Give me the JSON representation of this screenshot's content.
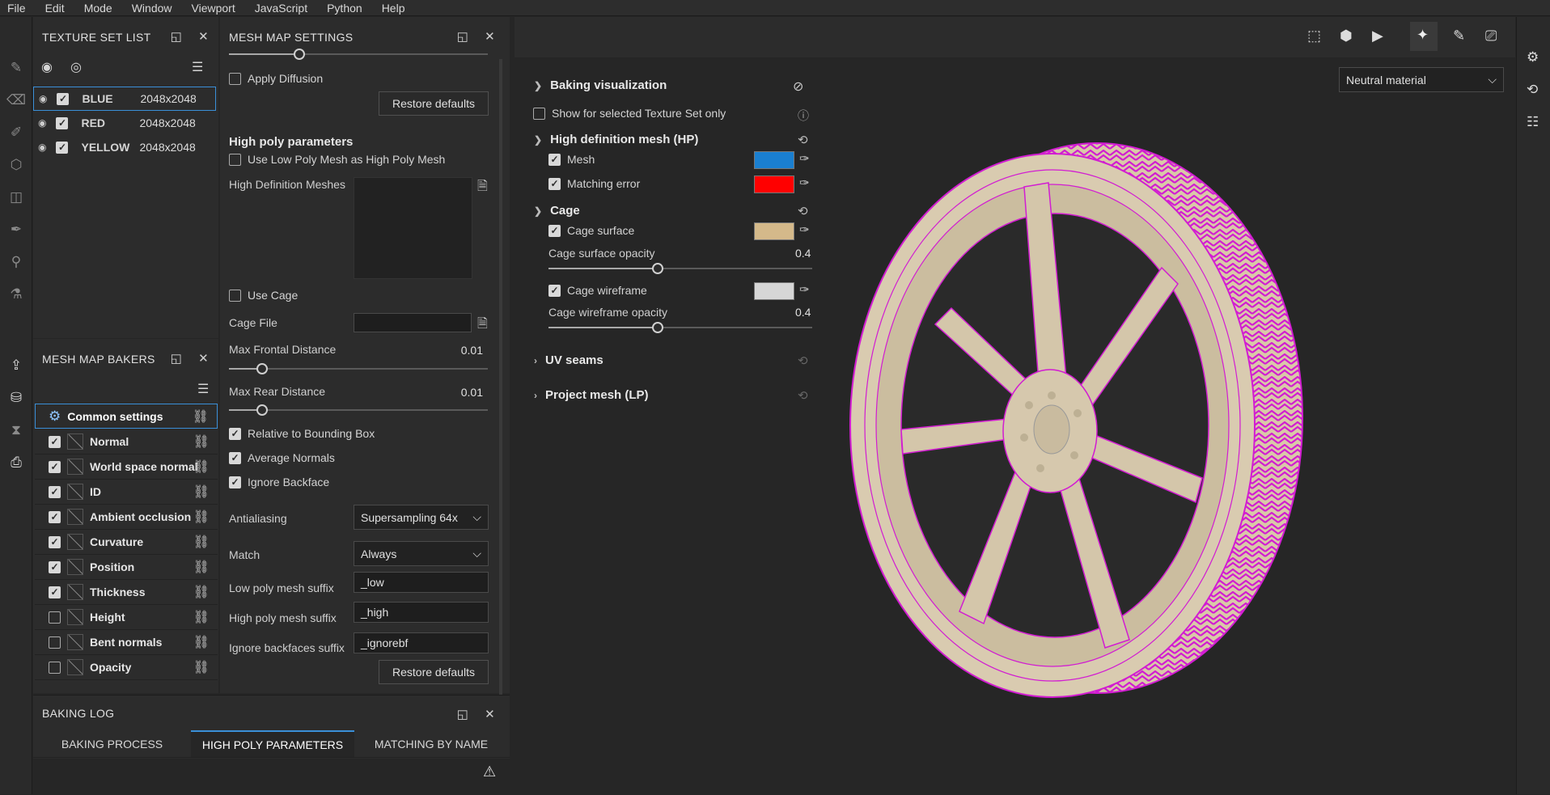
{
  "menu": [
    "File",
    "Edit",
    "Mode",
    "Window",
    "Viewport",
    "JavaScript",
    "Python",
    "Help"
  ],
  "texture_set_list": {
    "title": "TEXTURE SET LIST",
    "rows": [
      {
        "name": "BLUE",
        "size": "2048x2048"
      },
      {
        "name": "RED",
        "size": "2048x2048"
      },
      {
        "name": "YELLOW",
        "size": "2048x2048"
      }
    ]
  },
  "mesh_map_bakers": {
    "title": "MESH MAP BAKERS",
    "common": "Common settings",
    "items": [
      {
        "label": "Normal",
        "checked": true
      },
      {
        "label": "World space normal",
        "checked": true
      },
      {
        "label": "ID",
        "checked": true
      },
      {
        "label": "Ambient occlusion",
        "checked": true
      },
      {
        "label": "Curvature",
        "checked": true
      },
      {
        "label": "Position",
        "checked": true
      },
      {
        "label": "Thickness",
        "checked": true
      },
      {
        "label": "Height",
        "checked": false
      },
      {
        "label": "Bent normals",
        "checked": false
      },
      {
        "label": "Opacity",
        "checked": false
      }
    ]
  },
  "mesh_map_settings": {
    "title": "MESH MAP SETTINGS",
    "apply_diffusion": "Apply Diffusion",
    "restore_defaults_1": "Restore defaults",
    "high_poly_title": "High poly parameters",
    "use_low_poly": "Use Low Poly Mesh as High Poly Mesh",
    "hd_meshes": "High Definition Meshes",
    "use_cage": "Use Cage",
    "cage_file": "Cage File",
    "max_frontal": "Max Frontal Distance",
    "max_frontal_val": "0.01",
    "max_rear": "Max Rear Distance",
    "max_rear_val": "0.01",
    "relative_bbox": "Relative to Bounding Box",
    "avg_normals": "Average Normals",
    "ignore_backface": "Ignore Backface",
    "antialiasing": "Antialiasing",
    "antialiasing_val": "Supersampling 64x",
    "match": "Match",
    "match_val": "Always",
    "low_suffix": "Low poly mesh suffix",
    "low_suffix_val": "_low",
    "high_suffix": "High poly mesh suffix",
    "high_suffix_val": "_high",
    "ignore_suffix": "Ignore backfaces suffix",
    "ignore_suffix_val": "_ignorebf",
    "restore_defaults_2": "Restore defaults"
  },
  "baking_log": {
    "title": "BAKING LOG",
    "tabs": [
      "BAKING PROCESS",
      "HIGH POLY PARAMETERS",
      "MATCHING BY NAME"
    ]
  },
  "baking_vis": {
    "title": "Baking visualization",
    "show_selected": "Show for selected Texture Set only",
    "hp_title": "High definition mesh (HP)",
    "mesh": "Mesh",
    "mesh_color": "#1a7fd0",
    "matching_error": "Matching error",
    "matching_color": "#ff0000",
    "cage_title": "Cage",
    "cage_surface": "Cage surface",
    "cage_surface_color": "#d4b98a",
    "cage_surface_opacity": "Cage surface opacity",
    "cage_surface_opacity_val": "0.4",
    "cage_wireframe": "Cage wireframe",
    "cage_wireframe_color": "#d6d6d6",
    "cage_wireframe_opacity": "Cage wireframe opacity",
    "cage_wireframe_opacity_val": "0.4",
    "uv_seams": "UV seams",
    "project_mesh": "Project mesh (LP)"
  },
  "viewport": {
    "material": "Neutral material"
  }
}
